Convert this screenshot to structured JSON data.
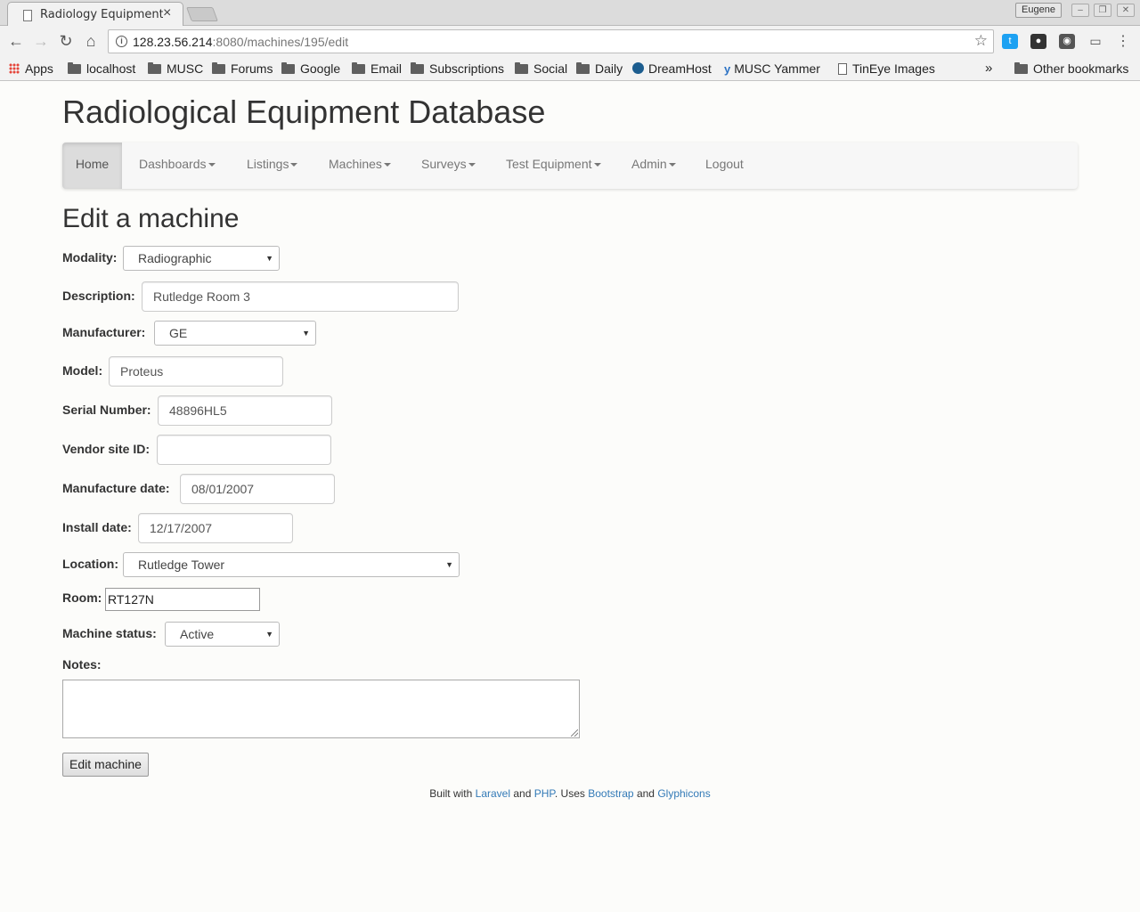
{
  "browser": {
    "tab_title": "Radiology Equipment",
    "profile": "Eugene",
    "url_host": "128.23.56.214",
    "url_rest": ":8080/machines/195/edit",
    "bookmarks": [
      "Apps",
      "localhost",
      "MUSC",
      "Forums",
      "Google",
      "Email",
      "Subscriptions",
      "Social",
      "Daily",
      "DreamHost",
      "MUSC Yammer",
      "TinEye Images"
    ],
    "more_bookmarks": "»",
    "other_bookmarks": "Other bookmarks"
  },
  "site": {
    "title": "Radiological Equipment Database"
  },
  "nav": {
    "items": [
      "Home",
      "Dashboards",
      "Listings",
      "Machines",
      "Surveys",
      "Test Equipment",
      "Admin",
      "Logout"
    ]
  },
  "form": {
    "heading": "Edit a machine",
    "modality_label": "Modality:",
    "modality_value": "Radiographic",
    "description_label": "Description:",
    "description_value": "Rutledge Room 3",
    "manufacturer_label": "Manufacturer:",
    "manufacturer_value": "GE",
    "model_label": "Model:",
    "model_value": "Proteus",
    "serial_label": "Serial Number:",
    "serial_value": "48896HL5",
    "vendor_label": "Vendor site ID:",
    "vendor_value": "",
    "manufacture_date_label": "Manufacture date:",
    "manufacture_date_value": "08/01/2007",
    "install_date_label": "Install date:",
    "install_date_value": "12/17/2007",
    "location_label": "Location:",
    "location_value": "Rutledge Tower",
    "room_label": "Room:",
    "room_value": "RT127N",
    "status_label": "Machine status:",
    "status_value": "Active",
    "notes_label": "Notes:",
    "notes_value": "",
    "submit_label": "Edit machine"
  },
  "footer": {
    "built_with": "Built with",
    "laravel": "Laravel",
    "and1": "and",
    "php": "PHP",
    "uses": ". Uses",
    "bootstrap": "Bootstrap",
    "and2": "and",
    "glyphicons": "Glyphicons"
  }
}
